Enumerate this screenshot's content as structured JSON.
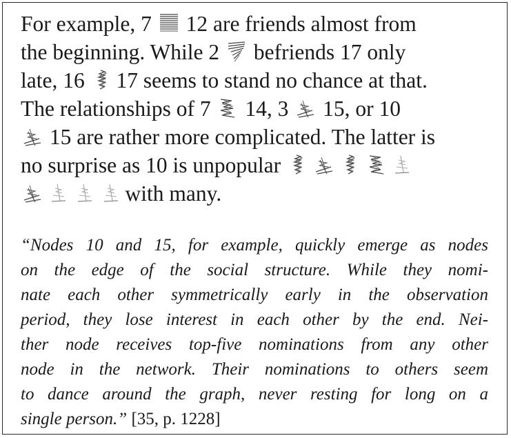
{
  "paragraph": {
    "line1": {
      "a": "For example, 7",
      "b": "12 are friends almost from"
    },
    "line2": {
      "a": "the beginning.  While 2",
      "b": "befriends 17 only"
    },
    "line3": {
      "a": "late, 16",
      "b": "17 seems to stand no chance at that."
    },
    "line4": {
      "a": "The relationships of 7",
      "b": "14,   3",
      "c": "15,   or 10"
    },
    "line5": {
      "a": "15 are rather more complicated. The latter is"
    },
    "line6": {
      "a": "no surprise as 10 is unpopular"
    },
    "line7": {
      "a": "with many."
    }
  },
  "glyphs": [
    "dense-horizontal-strokes-icon",
    "diagonal-hatch-icon",
    "vertical-stripe-icon",
    "wavy-stroke-icon",
    "cross-hatch-icon",
    "faint-scribble-icon"
  ],
  "quote": {
    "lines": [
      "“Nodes 10 and 15, for example, quickly emerge as nodes",
      "on the edge of the social structure.  While they nomi-",
      "nate each other symmetrically early in the observation",
      "period, they lose interest in each other by the end. Nei-",
      "ther node receives top-five nominations from any other",
      "node in the network.  Their nominations to others seem",
      "to dance around the graph, never resting for long on a"
    ],
    "last_line": "single person.”",
    "citation": "[35, p. 1228]"
  }
}
